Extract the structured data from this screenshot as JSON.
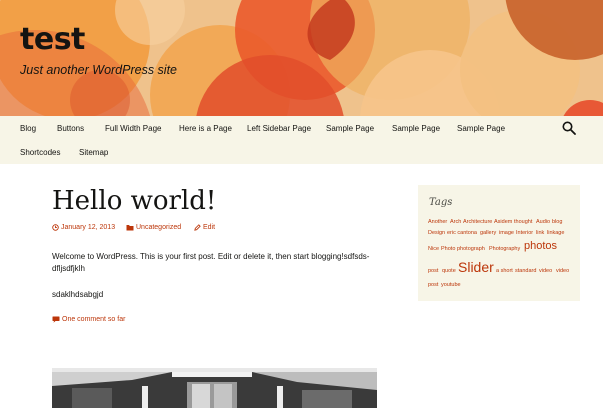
{
  "site": {
    "title": "test",
    "tagline": "Just another WordPress site"
  },
  "nav": {
    "items": [
      "Blog",
      "Buttons",
      "Full Width Page",
      "Here is a Page",
      "Left Sidebar Page",
      "Sample Page",
      "Sample Page",
      "Sample Page",
      "Shortcodes",
      "Sitemap"
    ],
    "search_icon": "search-icon"
  },
  "post": {
    "title": "Hello world!",
    "date": "January 12, 2013",
    "category": "Uncategorized",
    "edit_label": "Edit",
    "body": [
      "Welcome to WordPress. This is your first post. Edit or delete it, then start blogging!sdfsds-",
      "dfljsdfjklh",
      "sdaklhdsabgjd"
    ],
    "comments_label": "One comment so far"
  },
  "sidebar": {
    "widget_title": "Tags",
    "tags": [
      "Another",
      "Arch",
      "Architecture",
      "Asidem",
      "thought",
      "Audio",
      "blog",
      "Design",
      "eric cantona",
      "gallery",
      "image",
      "Interior",
      "link",
      "linkage",
      "Nice",
      "Photo",
      "photograph",
      "Photography",
      "photos",
      "post",
      "quote",
      "Slider",
      "a short",
      "standard",
      "video",
      "video",
      "post",
      "youtube"
    ]
  },
  "colors": {
    "accent": "#bc360a",
    "nav_bg": "#f7f5e7",
    "header_bg": "#e3b37d"
  }
}
